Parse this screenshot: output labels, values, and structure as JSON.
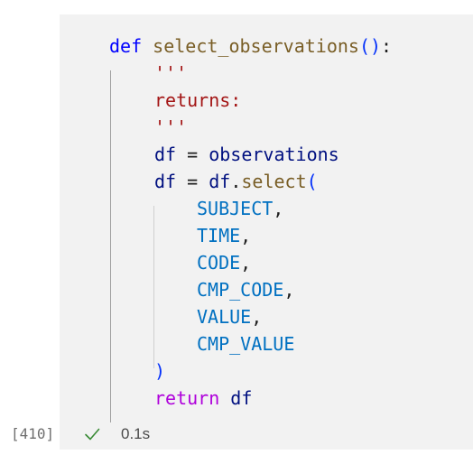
{
  "cell": {
    "execution_count": "[410]",
    "status_icon": "check-icon",
    "duration": "0.1s",
    "code": {
      "l1_def": "def",
      "l1_name": "select_observations",
      "l1_parens": "()",
      "l1_colon": ":",
      "l2_doc_open": "'''",
      "l3_returns": "returns:",
      "l4_doc_close": "'''",
      "l5_df": "df",
      "l5_eq": " = ",
      "l5_obs": "observations",
      "l6_df": "df",
      "l6_eq": " = ",
      "l6_df2": "df",
      "l6_dot": ".",
      "l6_select": "select",
      "l6_paren": "(",
      "l7": "SUBJECT",
      "l8": "TIME",
      "l9": "CODE",
      "l10": "CMP_CODE",
      "l11": "VALUE",
      "l12": "CMP_VALUE",
      "comma": ",",
      "l13_close": ")",
      "l14_return": "return",
      "l14_df": " df"
    }
  },
  "colors": {
    "keyword": "#0000ff",
    "function": "#795e26",
    "string": "#a31515",
    "variable": "#001080",
    "constant": "#0070c1",
    "control": "#af00db",
    "success": "#388a34"
  }
}
